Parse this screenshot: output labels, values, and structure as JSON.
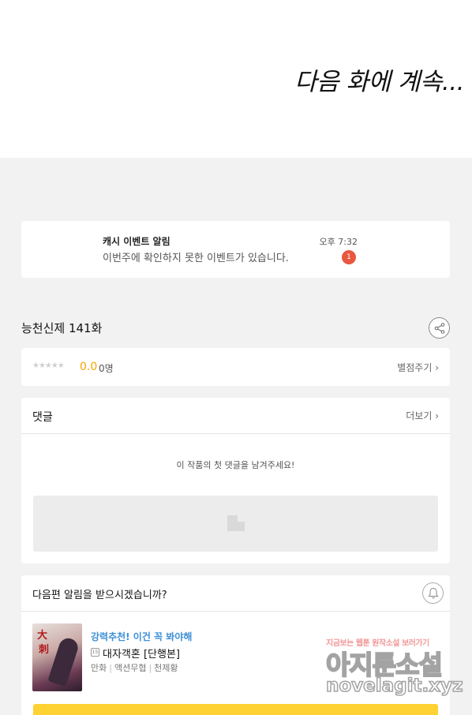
{
  "viewer": {
    "continued_text": "다음 화에 계속..."
  },
  "notification": {
    "title": "캐시 이벤트 알림",
    "message": "이번주에 확인하지 못한 이벤트가 있습니다.",
    "time": "오후 7:32",
    "badge_count": "1"
  },
  "episode": {
    "title": "능천신제 141화",
    "share_icon": "share-icon"
  },
  "rating": {
    "stars": "★★★★★",
    "score": "0.0",
    "count": "0명",
    "rate_link": "별점주기 ›"
  },
  "comments": {
    "heading": "댓글",
    "more_link": "더보기 ›",
    "empty_message": "이 작품의 첫 댓글을 남겨주세요!"
  },
  "next_alert": {
    "question": "다음편 알림을 받으시겠습니까?",
    "bell_icon": "bell-icon"
  },
  "recommendation": {
    "promo": "강력추천! 이건 꼭 봐야해",
    "age_rating": "15",
    "work_title": "대자객혼 [단행본]",
    "tags": [
      "만화",
      "액션무협",
      "천제황"
    ],
    "cover_text": [
      "大",
      "刺"
    ]
  },
  "watermark": {
    "line1": "지금보는 웹툰 원작소설 보러가기",
    "line2": "아지툰소설",
    "line3": "novelagit.xyz"
  },
  "colors": {
    "accent_yellow": "#ffd233",
    "score_orange": "#f5a500",
    "badge_red": "#e9573f",
    "promo_blue": "#3e8fd6"
  }
}
